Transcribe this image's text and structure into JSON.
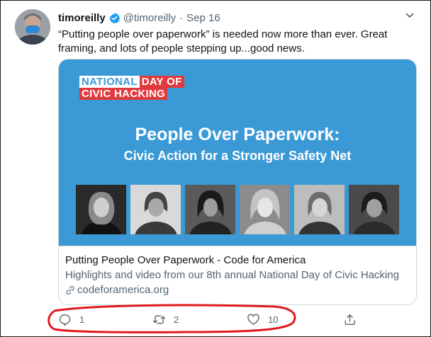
{
  "tweet": {
    "author_name": "timoreilly",
    "handle": "@timoreilly",
    "separator": "·",
    "date": "Sep 16",
    "text": "“Putting people over paperwork” is needed now more than ever. Great framing, and lots of people stepping up...good news."
  },
  "card": {
    "image": {
      "logo_line1_a": "NATIONAL",
      "logo_line1_b": "DAY OF",
      "logo_line2": "CIVIC HACKING",
      "title": "People Over Paperwork:",
      "subtitle": "Civic Action for a Stronger Safety Net",
      "background_color": "#3b9ad6"
    },
    "title": "Putting People Over Paperwork - Code for America",
    "description": "Highlights and video from our 8th annual National Day of Civic Hacking",
    "domain": "codeforamerica.org"
  },
  "actions": {
    "reply_count": "1",
    "retweet_count": "2",
    "like_count": "10"
  },
  "icons": {
    "verified": "verified-badge-icon",
    "more": "chevron-down-icon",
    "reply": "reply-icon",
    "retweet": "retweet-icon",
    "like": "heart-icon",
    "share": "share-icon",
    "link": "link-icon"
  },
  "colors": {
    "accent": "#1d9bf0",
    "secondary_text": "#536471",
    "annotation": "#e0191c"
  }
}
